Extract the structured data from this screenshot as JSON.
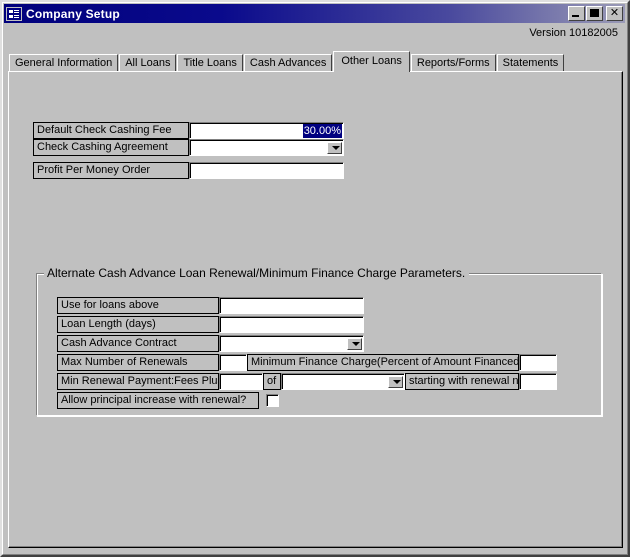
{
  "window": {
    "title": "Company Setup",
    "icon": "form-window-icon",
    "controls": {
      "minimize": "_",
      "maximize": "□",
      "close": "✕"
    }
  },
  "version_label": "Version 10182005",
  "tabs": [
    {
      "label": "General Information",
      "active": false
    },
    {
      "label": "All Loans",
      "active": false
    },
    {
      "label": "Title Loans",
      "active": false
    },
    {
      "label": "Cash Advances",
      "active": false
    },
    {
      "label": "Other Loans",
      "active": true
    },
    {
      "label": "Reports/Forms",
      "active": false
    },
    {
      "label": "Statements",
      "active": false
    }
  ],
  "top_fields": {
    "default_check_cashing_fee": {
      "label": "Default Check Cashing Fee",
      "value": "30.00%"
    },
    "check_cashing_agreement": {
      "label": "Check Cashing Agreement",
      "value": ""
    },
    "profit_per_money_order": {
      "label": "Profit Per Money Order",
      "value": ""
    }
  },
  "group": {
    "legend": "Alternate Cash Advance Loan Renewal/Minimum Finance Charge Parameters.",
    "use_for_loans_above": {
      "label": "Use for loans above",
      "value": ""
    },
    "loan_length_days": {
      "label": "Loan Length (days)",
      "value": ""
    },
    "cash_advance_contract": {
      "label": "Cash Advance Contract",
      "value": ""
    },
    "max_number_of_renewals": {
      "label": "Max Number of Renewals",
      "value": ""
    },
    "minimum_finance_charge": {
      "label": "Minimum Finance Charge(Percent of Amount Financed)",
      "value": ""
    },
    "min_renewal_payment": {
      "label": "Min Renewal Payment:Fees Plus",
      "value": "",
      "of_label": "of",
      "of_value": "",
      "starting_label": "starting with renewal no.",
      "starting_value": ""
    },
    "allow_principal_increase": {
      "label": "Allow principal increase with renewal?",
      "checked": false
    }
  },
  "colors": {
    "face": "#c0c0c0",
    "titlebar_start": "#00007c",
    "titlebar_end": "#9a9ab6",
    "selection": "#000080",
    "field_bg": "#ffffff"
  }
}
